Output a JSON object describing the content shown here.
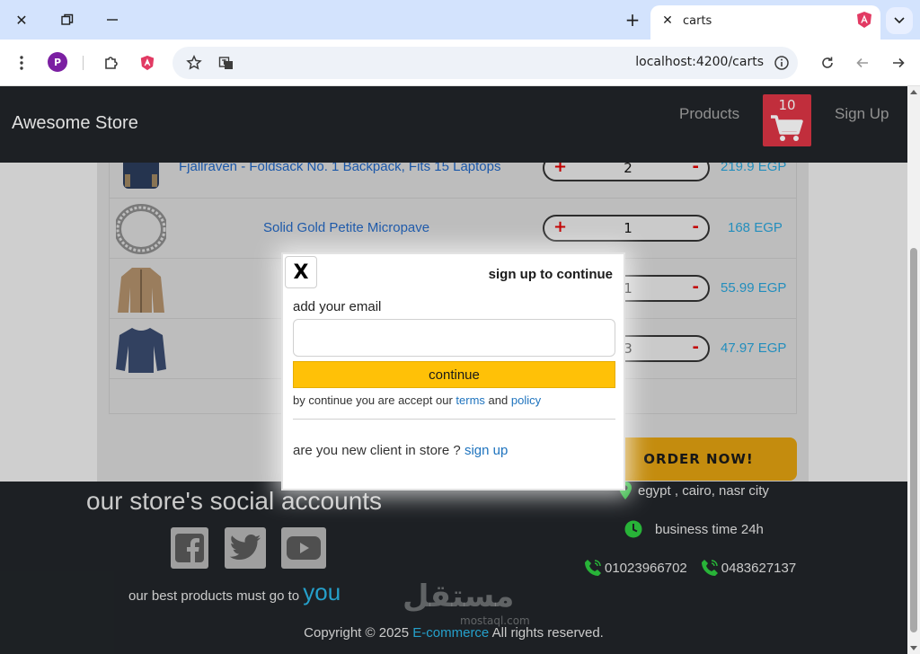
{
  "browser": {
    "tab_title": "carts",
    "url": "localhost:4200/carts",
    "profile_initial": "P"
  },
  "navbar": {
    "brand": "Awesome Store",
    "products_label": "Products",
    "cart_count": "10",
    "signup_label": "Sign Up"
  },
  "cart": {
    "items": [
      {
        "name": "Fjallraven - Foldsack No. 1 Backpack, Fits 15 Laptops",
        "qty": "2",
        "price": "219.9 EGP",
        "plus": "+",
        "minus": "-"
      },
      {
        "name": "Solid Gold Petite Micropave",
        "qty": "1",
        "price": "168 EGP",
        "plus": "+",
        "minus": "-"
      },
      {
        "name": "",
        "qty": "1",
        "price": "55.99 EGP",
        "plus": "+",
        "minus": "-"
      },
      {
        "name": "",
        "qty": "3",
        "price": "47.97 EGP",
        "plus": "+",
        "minus": "-"
      }
    ],
    "order_label": "ORDER NOW!"
  },
  "footer": {
    "social_title": "our store's social accounts",
    "tagline_prefix": "our best products must go to",
    "tagline_highlight": "you",
    "address": "egypt , cairo, nasr city",
    "business_time": "business time 24h",
    "phone1": "01023966702",
    "phone2": "0483627137",
    "copyright_prefix": "Copyright © 2025",
    "copyright_link": "E-commerce",
    "copyright_suffix": "All rights reserved.",
    "watermark": "مستقل",
    "watermark_sub": "mostaql.com"
  },
  "modal": {
    "close_label": "X",
    "title": "sign up to continue",
    "email_label": "add your email",
    "email_value": "",
    "continue_label": "continue",
    "terms_prefix": "by continue you are accept our",
    "terms_link": "terms",
    "and_text": "and",
    "policy_link": "policy",
    "new_client_text": "are you new client in store ?",
    "signup_link": "sign up"
  },
  "colors": {
    "navbar_bg": "#212529",
    "cart_badge": "#dc3545",
    "price_text": "#28a2d8",
    "continue_button": "#ffc107",
    "order_button": "#e0a010"
  }
}
